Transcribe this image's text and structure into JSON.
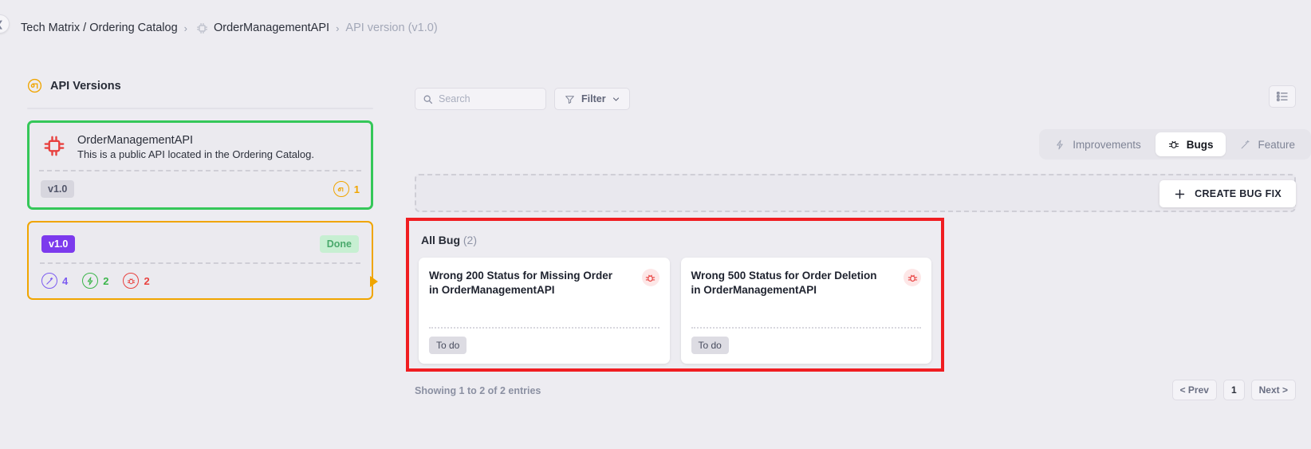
{
  "breadcrumb": {
    "collapse_icon": "chevron-left-icon",
    "root": "Tech Matrix / Ordering Catalog",
    "sep1": "›",
    "api_icon": "chip-icon",
    "api_name": "OrderManagementAPI",
    "sep2": "›",
    "current": "API version (v1.0)"
  },
  "sidebar": {
    "header": {
      "icon": "api-versions-icon",
      "title": "API Versions"
    },
    "api_card": {
      "icon": "chip-icon",
      "title": "OrderManagementAPI",
      "description": "This is a public API located in the Ordering Catalog.",
      "version_tag": "v1.0",
      "versions_icon": "api-versions-icon",
      "versions_count": "1"
    },
    "version_card": {
      "version_tag": "v1.0",
      "status": "Done",
      "stats": [
        {
          "icon": "magic-wand-icon",
          "value": "4",
          "color": "#7c5cf0"
        },
        {
          "icon": "bolt-icon",
          "value": "2",
          "color": "#3bb54a"
        },
        {
          "icon": "bug-icon",
          "value": "2",
          "color": "#e8413f"
        }
      ]
    },
    "marker_icon": "orange-play-arrow-icon"
  },
  "toolbar": {
    "search_placeholder": "Search",
    "search_value": "",
    "search_icon": "search-icon",
    "filter_label": "Filter",
    "filter_icon": "funnel-icon",
    "filter_caret": "⌄",
    "list_view_icon": "list-view-icon"
  },
  "tabs": [
    {
      "label": "Improvements",
      "icon": "bolt-icon",
      "active": false
    },
    {
      "label": "Bugs",
      "icon": "bug-icon",
      "active": true
    },
    {
      "label": "Feature",
      "icon": "magic-wand-icon",
      "active": false
    }
  ],
  "create": {
    "plus_icon": "plus-icon",
    "label": "CREATE BUG FIX"
  },
  "bugs_section": {
    "title": "All Bug",
    "count": "(2)",
    "cards": [
      {
        "title": "Wrong 200 Status for Missing Order in OrderManagementAPI",
        "icon": "bug-icon",
        "status": "To do"
      },
      {
        "title": "Wrong 500 Status for Order Deletion in OrderManagementAPI",
        "icon": "bug-icon",
        "status": "To do"
      }
    ]
  },
  "footer": {
    "showing": "Showing 1 to 2 of 2 entries",
    "prev": "< Prev",
    "page": "1",
    "next": "Next >"
  },
  "colors": {
    "selection_green": "#35c759",
    "highlight_red": "#f01d21",
    "accent_orange": "#f0a500",
    "purple": "#7c3aed"
  }
}
